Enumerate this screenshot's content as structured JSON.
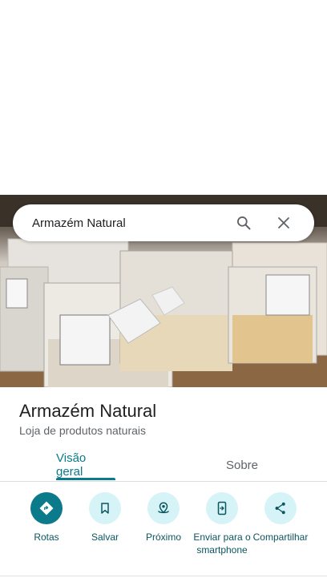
{
  "search": {
    "query": "Armazém Natural"
  },
  "place": {
    "name": "Armazém Natural",
    "category": "Loja de produtos naturais"
  },
  "tabs": [
    {
      "label": "Visão geral"
    },
    {
      "label": "Sobre"
    }
  ],
  "actions": [
    {
      "label": "Rotas",
      "icon": "directions-icon"
    },
    {
      "label": "Salvar",
      "icon": "bookmark-icon"
    },
    {
      "label": "Próximo",
      "icon": "nearby-icon"
    },
    {
      "label": "Enviar para o smartphone",
      "icon": "send-to-phone-icon"
    },
    {
      "label": "Compartilhar",
      "icon": "share-icon"
    }
  ],
  "colors": {
    "accent": "#0b7a8a",
    "action_bg": "#d6f4f7"
  }
}
